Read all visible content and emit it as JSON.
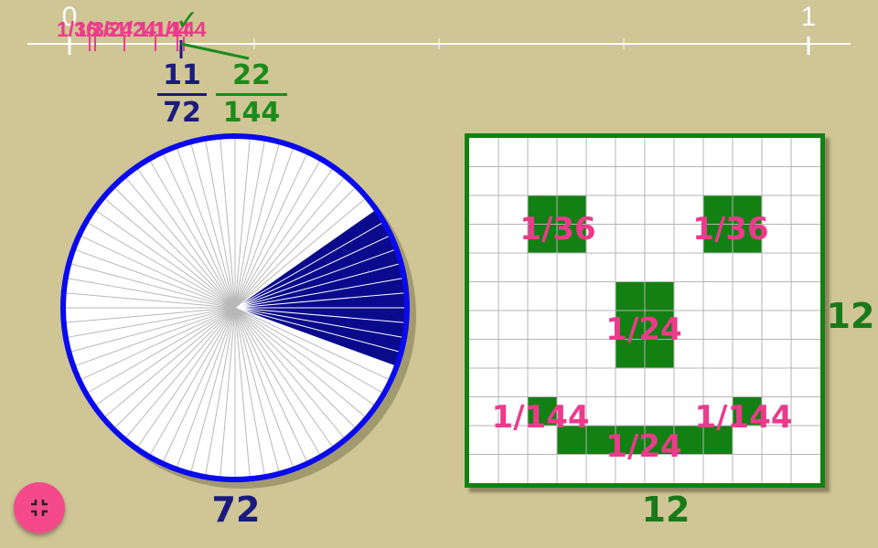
{
  "number_line": {
    "start_label": "0",
    "end_label": "1",
    "marker_labels": [
      "1/36",
      "1/36",
      "1/24",
      "1/24",
      "1/144",
      "1/144"
    ],
    "check_symbol": "✓",
    "colors": {
      "line": "#ffffff",
      "markers": "#ec3a8c",
      "check": "#1a8c1a",
      "pointer": "#1a1a80"
    }
  },
  "fraction_blue": {
    "numerator": "11",
    "denominator": "72",
    "color": "#1a1a80"
  },
  "fraction_green": {
    "numerator": "22",
    "denominator": "144",
    "color": "#1a8c1a"
  },
  "pie": {
    "total_slices": 72,
    "filled_slices": 11,
    "count_label": "72",
    "colors": {
      "outline": "#0a0aee",
      "fill": "#0a0a8c",
      "spokes": "#b8b8b8"
    }
  },
  "grid": {
    "rows": 12,
    "cols": 12,
    "width_label": "12",
    "height_label": "12",
    "colors": {
      "frame": "#128012",
      "fill": "#128012",
      "lines": "#b4b4b4"
    },
    "pieces": [
      {
        "label": "1/36"
      },
      {
        "label": "1/36"
      },
      {
        "label": "1/24"
      },
      {
        "label": "1/144"
      },
      {
        "label": "1/144"
      },
      {
        "label": "1/24"
      }
    ]
  },
  "fab": {
    "icon": "grid-shrink-icon",
    "color": "#f44a8c"
  }
}
